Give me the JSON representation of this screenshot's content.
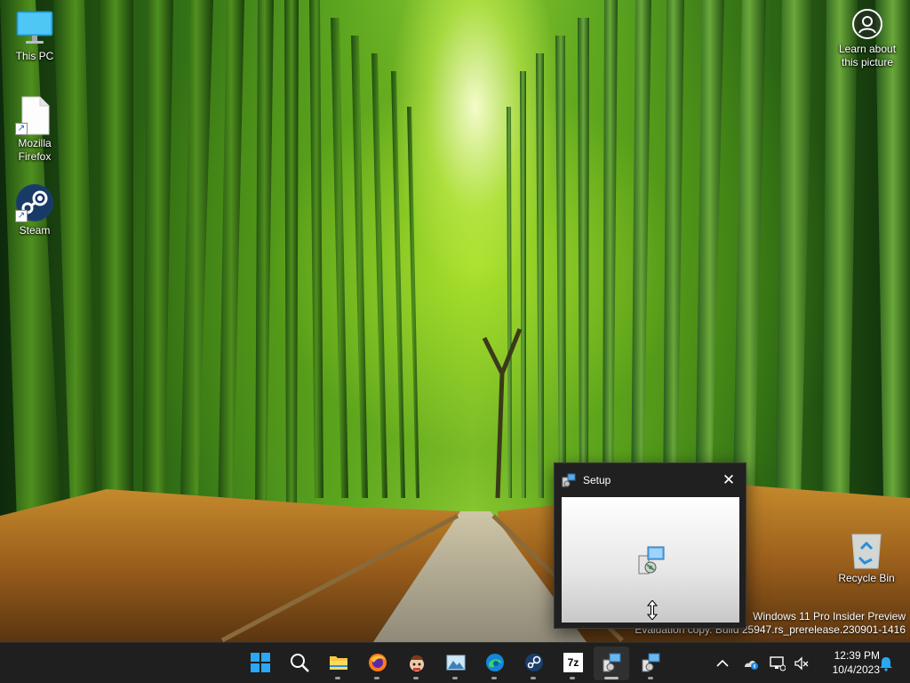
{
  "desktop": {
    "icons": [
      {
        "label": "This PC",
        "icon": "monitor-icon"
      },
      {
        "label": "Mozilla Firefox",
        "icon": "file-shortcut-icon"
      },
      {
        "label": "Steam",
        "icon": "steam-icon"
      },
      {
        "label": "Recycle Bin",
        "icon": "recycle-bin-icon"
      }
    ],
    "spotlight_label": "Learn about this picture",
    "watermark": {
      "line1": "Windows 11 Pro Insider Preview",
      "line2": "Evaluation copy. Build 25947.rs_prerelease.230901-1416"
    }
  },
  "setup_window": {
    "title": "Setup",
    "close_glyph": "✕"
  },
  "taskbar": {
    "apps": [
      {
        "name": "start",
        "icon": "windows-start-icon"
      },
      {
        "name": "search",
        "icon": "search-icon"
      },
      {
        "name": "file-explorer",
        "icon": "folder-icon",
        "running": true
      },
      {
        "name": "firefox",
        "icon": "firefox-icon",
        "running": true
      },
      {
        "name": "app-mascot",
        "icon": "mascot-icon",
        "running": true
      },
      {
        "name": "photos",
        "icon": "photos-icon",
        "running": true
      },
      {
        "name": "edge",
        "icon": "edge-icon",
        "running": true
      },
      {
        "name": "steam",
        "icon": "steam-icon",
        "running": true
      },
      {
        "name": "7zip",
        "icon": "7zip-icon",
        "label": "7z",
        "running": true
      },
      {
        "name": "setup-1",
        "icon": "installer-icon",
        "running": true,
        "active": true
      },
      {
        "name": "setup-2",
        "icon": "installer-icon",
        "running": true
      }
    ],
    "clock": {
      "time": "12:39 PM",
      "date": "10/4/2023"
    },
    "tray_icons": [
      "chevron-up-icon",
      "onedrive-icon",
      "network-icon",
      "volume-muted-icon",
      "notification-bell-icon"
    ]
  }
}
